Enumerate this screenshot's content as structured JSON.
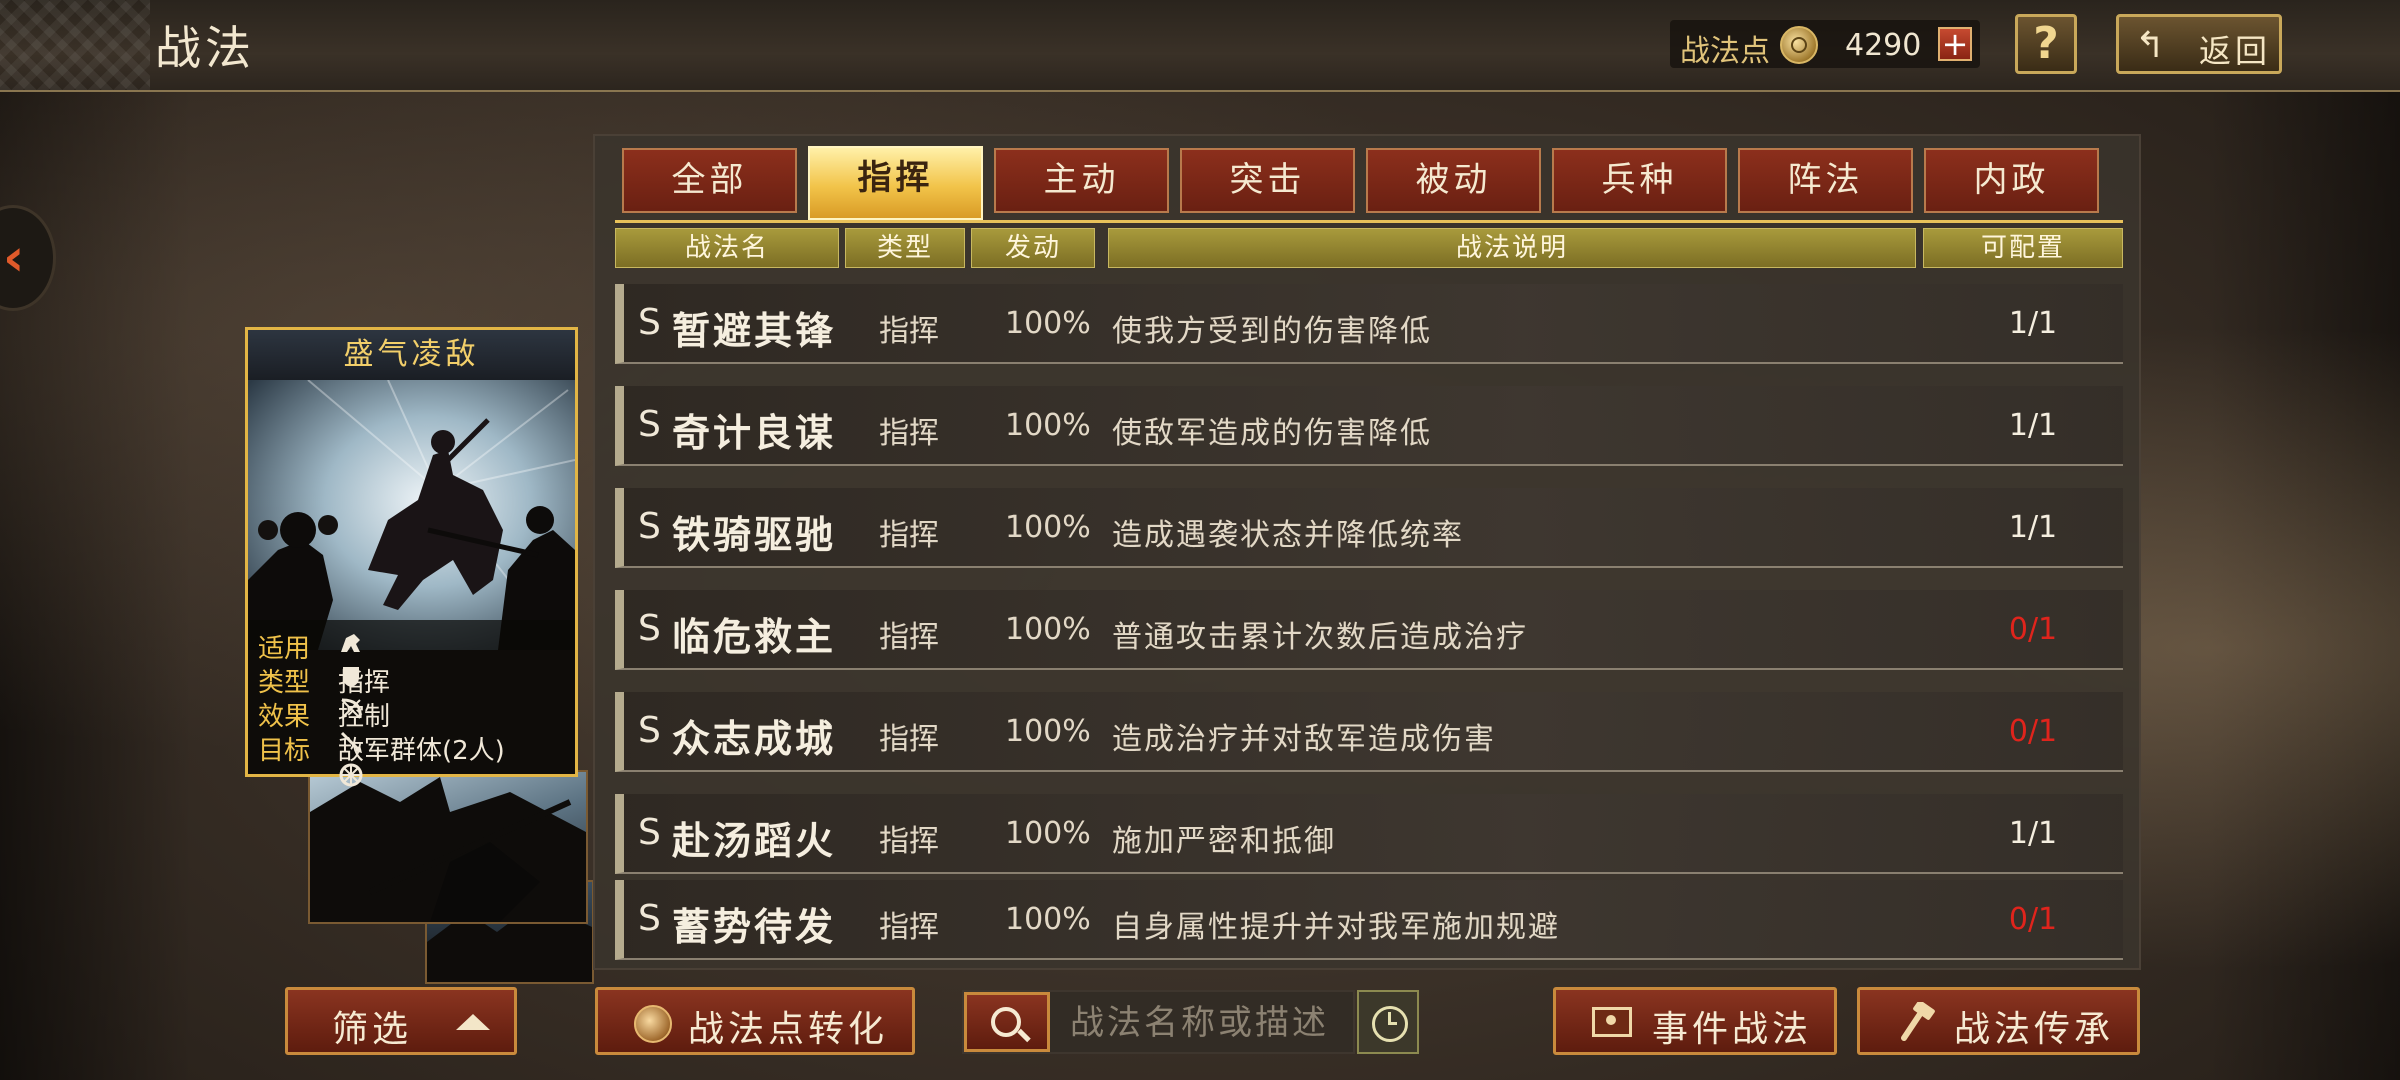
{
  "header": {
    "title": "战法",
    "points_label": "战法点",
    "points_value": "4290",
    "plus_label": "+",
    "help_label": "?",
    "back_label": "返回"
  },
  "card": {
    "title": "盛气凌敌",
    "info": [
      {
        "key": "适用",
        "value": ""
      },
      {
        "key": "类型",
        "value": "指挥"
      },
      {
        "key": "效果",
        "value": "控制"
      },
      {
        "key": "目标",
        "value": "敌军群体(2人)"
      }
    ],
    "unit_icons": [
      "cavalry-icon",
      "shield-icon",
      "bow-icon",
      "spear-icon",
      "wheel-icon"
    ]
  },
  "tabs": [
    {
      "label": "全部",
      "active": false
    },
    {
      "label": "指挥",
      "active": true
    },
    {
      "label": "主动",
      "active": false
    },
    {
      "label": "突击",
      "active": false
    },
    {
      "label": "被动",
      "active": false
    },
    {
      "label": "兵种",
      "active": false
    },
    {
      "label": "阵法",
      "active": false
    },
    {
      "label": "内政",
      "active": false
    }
  ],
  "columns": {
    "name": "战法名",
    "type": "类型",
    "rate": "发动",
    "desc": "战法说明",
    "count": "可配置"
  },
  "rows": [
    {
      "grade": "S",
      "name": "暂避其锋",
      "type": "指挥",
      "rate": "100%",
      "desc": "使我方受到的伤害降低",
      "count": "1/1",
      "available": true
    },
    {
      "grade": "S",
      "name": "奇计良谋",
      "type": "指挥",
      "rate": "100%",
      "desc": "使敌军造成的伤害降低",
      "count": "1/1",
      "available": true
    },
    {
      "grade": "S",
      "name": "铁骑驱驰",
      "type": "指挥",
      "rate": "100%",
      "desc": "造成遇袭状态并降低统率",
      "count": "1/1",
      "available": true
    },
    {
      "grade": "S",
      "name": "临危救主",
      "type": "指挥",
      "rate": "100%",
      "desc": "普通攻击累计次数后造成治疗",
      "count": "0/1",
      "available": false
    },
    {
      "grade": "S",
      "name": "众志成城",
      "type": "指挥",
      "rate": "100%",
      "desc": "造成治疗并对敌军造成伤害",
      "count": "0/1",
      "available": false
    },
    {
      "grade": "S",
      "name": "赴汤蹈火",
      "type": "指挥",
      "rate": "100%",
      "desc": "施加严密和抵御",
      "count": "1/1",
      "available": true
    },
    {
      "grade": "S",
      "name": "蓄势待发",
      "type": "指挥",
      "rate": "100%",
      "desc": "自身属性提升并对我军施加规避",
      "count": "0/1",
      "available": false
    }
  ],
  "bottom": {
    "filter_label": "筛选",
    "convert_label": "战法点转化",
    "search_placeholder": "战法名称或描述",
    "event_label": "事件战法",
    "inherit_label": "战法传承"
  },
  "colors": {
    "accent_gold": "#f2c44a",
    "tab_red": "#8c2f1c",
    "unavailable_red": "#e0241c"
  }
}
